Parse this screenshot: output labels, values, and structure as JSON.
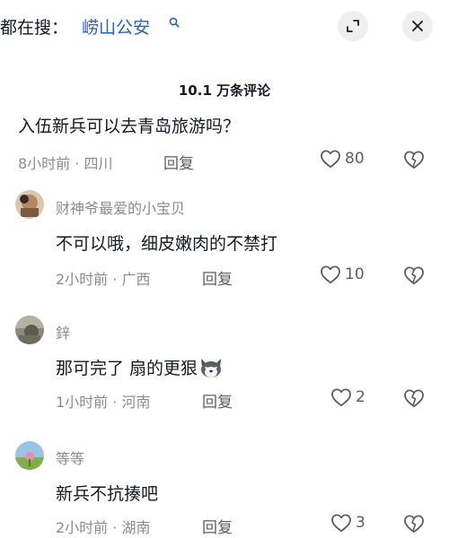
{
  "search": {
    "prefix": "都在搜：",
    "term": "崂山公安"
  },
  "header": {
    "comment_count": "10.1 万条评论"
  },
  "comments": [
    {
      "text": "入伍新兵可以去青岛旅游吗？",
      "meta": "8小时前 · 四川",
      "reply_label": "回复",
      "likes": "80"
    },
    {
      "author": "财神爷最爱的小宝贝",
      "text": "不可以哦，细皮嫩肉的不禁打",
      "meta": "2小时前 · 广西",
      "reply_label": "回复",
      "likes": "10"
    },
    {
      "author": "鋅",
      "text": "那可完了 扇的更狠",
      "emoji": "husky-dog-emoji",
      "meta": "1小时前 · 河南",
      "reply_label": "回复",
      "likes": "2"
    },
    {
      "author": "等等",
      "text": "新兵不抗揍吧",
      "meta": "2小时前 · 湖南",
      "reply_label": "回复",
      "likes": "3"
    }
  ],
  "colors": {
    "link": "#2b5fb3",
    "text": "#161823",
    "secondary": "#8a8b91"
  }
}
